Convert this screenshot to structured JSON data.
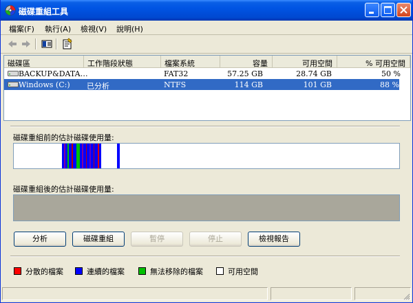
{
  "window": {
    "title": "磁碟重組工具",
    "accent": "#0054e3"
  },
  "menu": {
    "items": [
      "檔案(F)",
      "執行(A)",
      "檢視(V)",
      "說明(H)"
    ]
  },
  "toolbar": {
    "icons": [
      "back-arrow-icon",
      "forward-arrow-icon",
      "view-icon",
      "properties-icon"
    ]
  },
  "volumes": {
    "headers": [
      "磁碟區",
      "工作階段狀態",
      "檔案系統",
      "容量",
      "可用空間",
      "% 可用空間"
    ],
    "rows": [
      {
        "name": "BACKUP&DATA…",
        "status": "",
        "fs": "FAT32",
        "capacity": "57.25 GB",
        "free": "28.74 GB",
        "pct": "50 %"
      },
      {
        "name": "Windows (C:)",
        "status": "已分析",
        "fs": "NTFS",
        "capacity": "114 GB",
        "free": "101 GB",
        "pct": "88 %"
      }
    ],
    "selected_index": 1
  },
  "analysis": {
    "before_label": "磁碟重組前的估計磁碟使用量:",
    "after_label": "磁碟重組後的估計磁碟使用量:"
  },
  "buttons": {
    "analyze": "分析",
    "defragment": "磁碟重組",
    "pause": "暫停",
    "stop": "停止",
    "view_report": "檢視報告"
  },
  "legend": {
    "fragmented": "分散的檔案",
    "contiguous": "連續的檔案",
    "unmovable": "無法移除的檔案",
    "free": "可用空間",
    "colors": {
      "fragmented": "#ff0000",
      "contiguous": "#0000ff",
      "unmovable": "#00c000",
      "free": "#ffffff"
    }
  }
}
